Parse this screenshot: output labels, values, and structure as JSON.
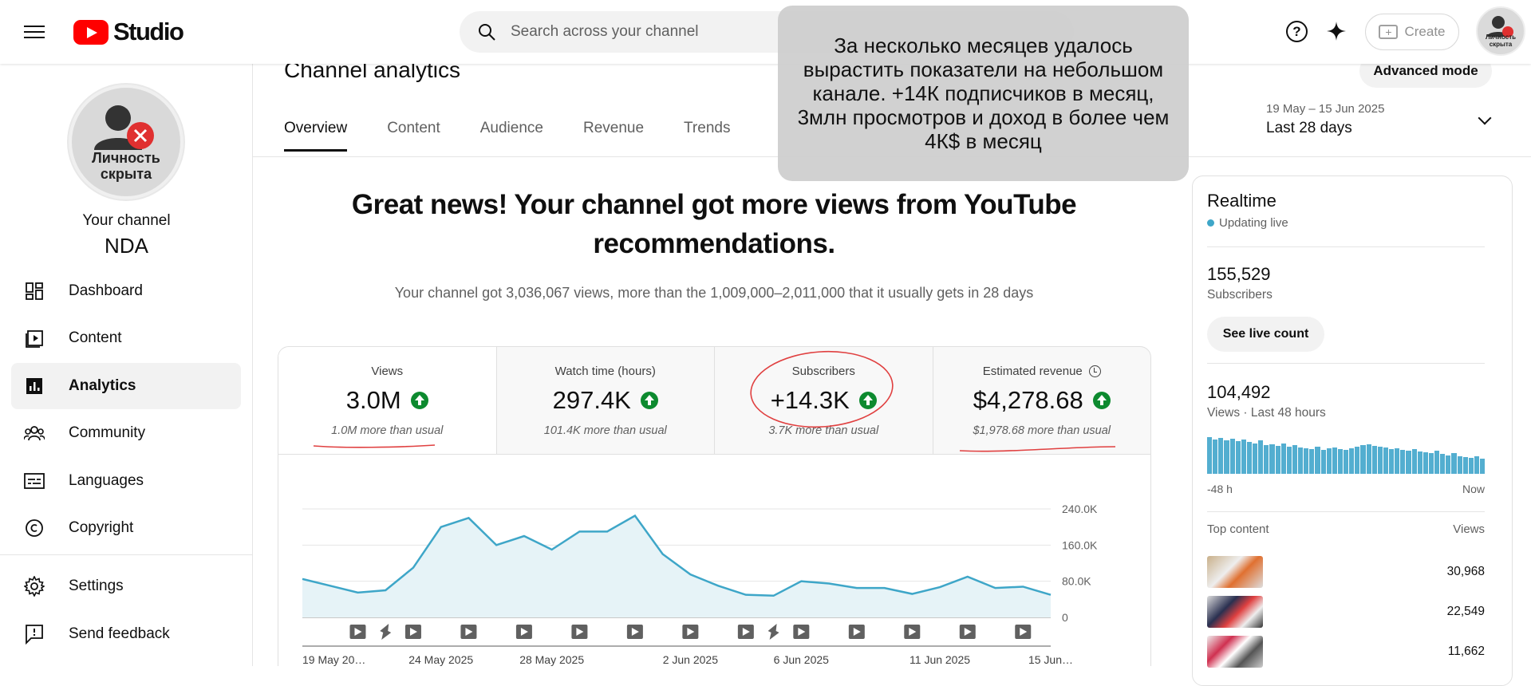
{
  "topbar": {
    "logo_text": "Studio",
    "search_placeholder": "Search across your channel",
    "help_label": "?",
    "create_label": "Create",
    "avatar_text": "Личность скрыта"
  },
  "sidebar": {
    "avatar_text_line1": "Личность",
    "avatar_text_line2": "скрыта",
    "your_channel": "Your channel",
    "channel_name": "NDA",
    "items": [
      {
        "label": "Dashboard",
        "icon": "dashboard-icon"
      },
      {
        "label": "Content",
        "icon": "content-icon"
      },
      {
        "label": "Analytics",
        "icon": "analytics-icon",
        "active": true
      },
      {
        "label": "Community",
        "icon": "community-icon"
      },
      {
        "label": "Languages",
        "icon": "languages-icon"
      },
      {
        "label": "Copyright",
        "icon": "copyright-icon"
      },
      {
        "label": "Settings",
        "icon": "gear-icon"
      },
      {
        "label": "Send feedback",
        "icon": "feedback-icon"
      }
    ]
  },
  "header": {
    "title": "Channel analytics",
    "advanced_mode": "Advanced mode",
    "tabs": [
      "Overview",
      "Content",
      "Audience",
      "Revenue",
      "Trends"
    ],
    "date_range": "19 May – 15 Jun 2025",
    "period": "Last 28 days"
  },
  "overlay_note": "За несколько месяцев удалось вырастить показатели на небольшом канале. +14К подписчиков в месяц, 3млн просмотров и доход в более чем 4К$ в месяц",
  "summary": {
    "headline": "Great news! Your channel got more views from YouTube recommendations.",
    "subline": "Your channel got 3,036,067 views, more than the 1,009,000–2,011,000 that it usually gets in 28 days"
  },
  "metrics": [
    {
      "title": "Views",
      "value": "3.0M",
      "note": "1.0M more than usual"
    },
    {
      "title": "Watch time (hours)",
      "value": "297.4K",
      "note": "101.4K more than usual"
    },
    {
      "title": "Subscribers",
      "value": "+14.3K",
      "note": "3.7K more than usual"
    },
    {
      "title": "Estimated revenue",
      "value": "$4,278.68",
      "note": "$1,978.68 more than usual"
    }
  ],
  "chart_data": {
    "type": "area",
    "series": [
      {
        "name": "Views",
        "values": [
          85,
          70,
          55,
          60,
          110,
          200,
          220,
          160,
          180,
          150,
          190,
          190,
          225,
          140,
          95,
          70,
          50,
          48,
          80,
          75,
          65,
          65,
          52,
          67,
          90,
          65,
          68,
          50
        ]
      }
    ],
    "y_ticks": [
      "240.0K",
      "160.0K",
      "80.0K",
      "0"
    ],
    "ylim": [
      0,
      240
    ],
    "x_labels": [
      "19 May 20…",
      "24 May 2025",
      "28 May 2025",
      "2 Jun 2025",
      "6 Jun 2025",
      "11 Jun 2025",
      "15 Jun…"
    ],
    "x_label_days": [
      0,
      5,
      9,
      14,
      18,
      23,
      27
    ],
    "markers": [
      {
        "day": 2,
        "kind": "video"
      },
      {
        "day": 3,
        "kind": "short"
      },
      {
        "day": 4,
        "kind": "video"
      },
      {
        "day": 6,
        "kind": "video"
      },
      {
        "day": 8,
        "kind": "video"
      },
      {
        "day": 10,
        "kind": "video"
      },
      {
        "day": 12,
        "kind": "video"
      },
      {
        "day": 14,
        "kind": "video"
      },
      {
        "day": 16,
        "kind": "video"
      },
      {
        "day": 17,
        "kind": "short"
      },
      {
        "day": 18,
        "kind": "video"
      },
      {
        "day": 20,
        "kind": "video"
      },
      {
        "day": 22,
        "kind": "video"
      },
      {
        "day": 24,
        "kind": "video"
      },
      {
        "day": 26,
        "kind": "video"
      }
    ],
    "colors": {
      "line": "#3ea6c8",
      "fill": "#e6f3f7",
      "marker": "#606060"
    }
  },
  "realtime": {
    "title": "Realtime",
    "status": "Updating live",
    "subscribers_value": "155,529",
    "subscribers_label": "Subscribers",
    "see_live_count": "See live count",
    "views_value": "104,492",
    "views_label": "Views · Last 48 hours",
    "bars": [
      90,
      85,
      88,
      82,
      86,
      80,
      84,
      78,
      75,
      82,
      70,
      72,
      68,
      74,
      66,
      70,
      64,
      62,
      60,
      66,
      58,
      62,
      64,
      60,
      58,
      62,
      66,
      70,
      72,
      68,
      66,
      64,
      60,
      62,
      58,
      56,
      60,
      54,
      52,
      50,
      56,
      48,
      46,
      50,
      44,
      42,
      40,
      44,
      38
    ],
    "axis_start": "-48 h",
    "axis_end": "Now",
    "top_content_label": "Top content",
    "views_col_label": "Views",
    "top_content": [
      {
        "views": "30,968"
      },
      {
        "views": "22,549"
      },
      {
        "views": "11,662"
      }
    ]
  }
}
